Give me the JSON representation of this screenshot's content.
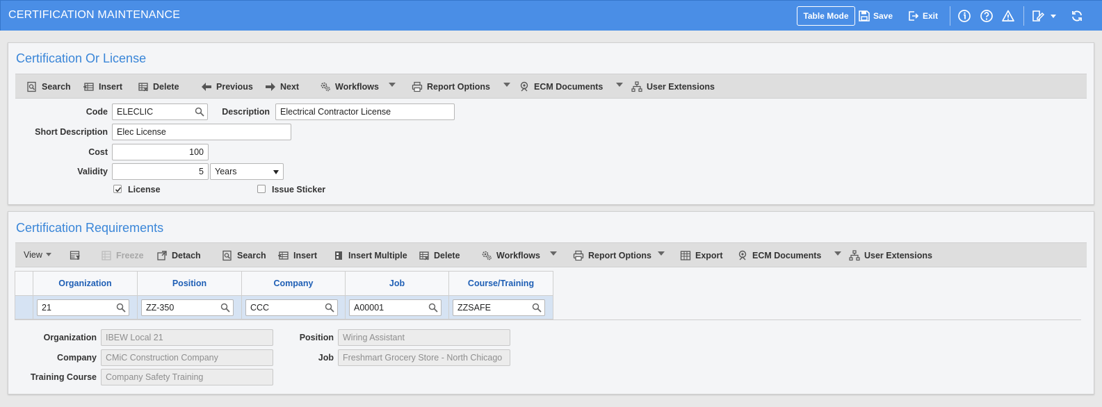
{
  "header": {
    "title": "CERTIFICATION MAINTENANCE",
    "table_mode": "Table Mode",
    "save": "Save",
    "exit": "Exit"
  },
  "cert_panel": {
    "title": "Certification Or License",
    "toolbar": {
      "search": "Search",
      "insert": "Insert",
      "delete": "Delete",
      "previous": "Previous",
      "next": "Next",
      "workflows": "Workflows",
      "report_options": "Report Options",
      "ecm_documents": "ECM Documents",
      "user_extensions": "User Extensions"
    },
    "form": {
      "code_label": "Code",
      "code_value": "ELECLIC",
      "description_label": "Description",
      "description_value": "Electrical Contractor License",
      "short_desc_label": "Short Description",
      "short_desc_value": "Elec License",
      "cost_label": "Cost",
      "cost_value": "100",
      "validity_label": "Validity",
      "validity_value": "5",
      "validity_unit": "Years",
      "license_label": "License",
      "license_checked": true,
      "issue_sticker_label": "Issue Sticker",
      "issue_sticker_checked": false
    }
  },
  "req_panel": {
    "title": "Certification Requirements",
    "toolbar": {
      "view": "View",
      "freeze": "Freeze",
      "detach": "Detach",
      "search": "Search",
      "insert": "Insert",
      "insert_multiple": "Insert Multiple",
      "delete": "Delete",
      "workflows": "Workflows",
      "report_options": "Report Options",
      "export": "Export",
      "ecm_documents": "ECM Documents",
      "user_extensions": "User Extensions"
    },
    "grid": {
      "columns": [
        "Organization",
        "Position",
        "Company",
        "Job",
        "Course/Training"
      ],
      "row": [
        "21",
        "ZZ-350",
        "CCC",
        "A00001",
        "ZZSAFE"
      ]
    },
    "details": {
      "organization_label": "Organization",
      "organization_value": "IBEW Local 21",
      "position_label": "Position",
      "position_value": "Wiring Assistant",
      "company_label": "Company",
      "company_value": "CMiC Construction Company",
      "job_label": "Job",
      "job_value": "Freshmart Grocery Store -  North Chicago",
      "training_label": "Training Course",
      "training_value": "Company Safety Training"
    }
  },
  "colors": {
    "header_bg": "#4a8ee6",
    "title_blue": "#3a86d8",
    "grid_header_text": "#1f5fb5",
    "grid_row_bg": "#d6e3f3"
  }
}
